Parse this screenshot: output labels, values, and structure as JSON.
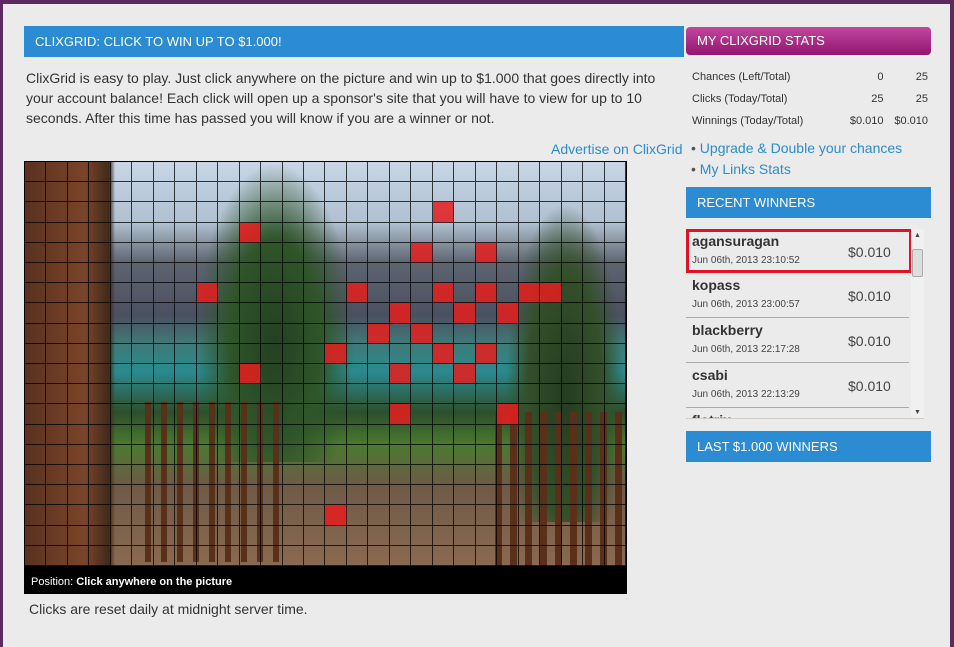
{
  "main": {
    "title": "CLIXGRID: CLICK TO WIN UP TO $1.000!",
    "intro": "ClixGrid is easy to play. Just click anywhere on the picture and win up to $1.000 that goes directly into your account balance! Each click will open up a sponsor's site that you will have to view for up to 10 seconds. After this time has passed you will know if you are a winner or not.",
    "advertise_link": "Advertise on ClixGrid",
    "position_label": "Position:",
    "position_value": "Click anywhere on the picture",
    "reset_note": "Clicks are reset daily at midnight server time.",
    "grid": {
      "columns": 28,
      "rows": 20,
      "clicked_cells": [
        [
          3,
          10
        ],
        [
          2,
          19
        ],
        [
          4,
          18
        ],
        [
          4,
          21
        ],
        [
          6,
          8
        ],
        [
          6,
          15
        ],
        [
          6,
          19
        ],
        [
          6,
          21
        ],
        [
          6,
          23
        ],
        [
          6,
          24
        ],
        [
          7,
          17
        ],
        [
          7,
          20
        ],
        [
          7,
          22
        ],
        [
          8,
          16
        ],
        [
          8,
          18
        ],
        [
          9,
          14
        ],
        [
          9,
          19
        ],
        [
          9,
          21
        ],
        [
          10,
          10
        ],
        [
          10,
          17
        ],
        [
          10,
          20
        ],
        [
          12,
          17
        ],
        [
          12,
          22
        ],
        [
          17,
          14
        ]
      ],
      "clicked_color": "#e61e1e"
    }
  },
  "stats": {
    "title": "MY CLIXGRID STATS",
    "rows": [
      {
        "label": "Chances (Left/Total)",
        "a": "0",
        "b": "25"
      },
      {
        "label": "Clicks (Today/Total)",
        "a": "25",
        "b": "25"
      },
      {
        "label": "Winnings (Today/Total)",
        "a": "$0.010",
        "b": "$0.010"
      }
    ],
    "links": [
      "Upgrade & Double your chances",
      "My Links Stats"
    ]
  },
  "recent": {
    "title": "RECENT WINNERS",
    "items": [
      {
        "name": "agansuragan",
        "date": "Jun 06th, 2013 23:10:52",
        "amount": "$0.010"
      },
      {
        "name": "kopass",
        "date": "Jun 06th, 2013 23:00:57",
        "amount": "$0.010"
      },
      {
        "name": "blackberry",
        "date": "Jun 06th, 2013 22:17:28",
        "amount": "$0.010"
      },
      {
        "name": "csabi",
        "date": "Jun 06th, 2013 22:13:29",
        "amount": "$0.010"
      },
      {
        "name": "flotrix",
        "date": "",
        "amount": ""
      }
    ]
  },
  "last": {
    "title": "LAST $1.000 WINNERS"
  },
  "colors": {
    "header_blue": "#2b8bd3",
    "stats_magenta": "#a0207a",
    "highlight_red": "#e0141e"
  }
}
